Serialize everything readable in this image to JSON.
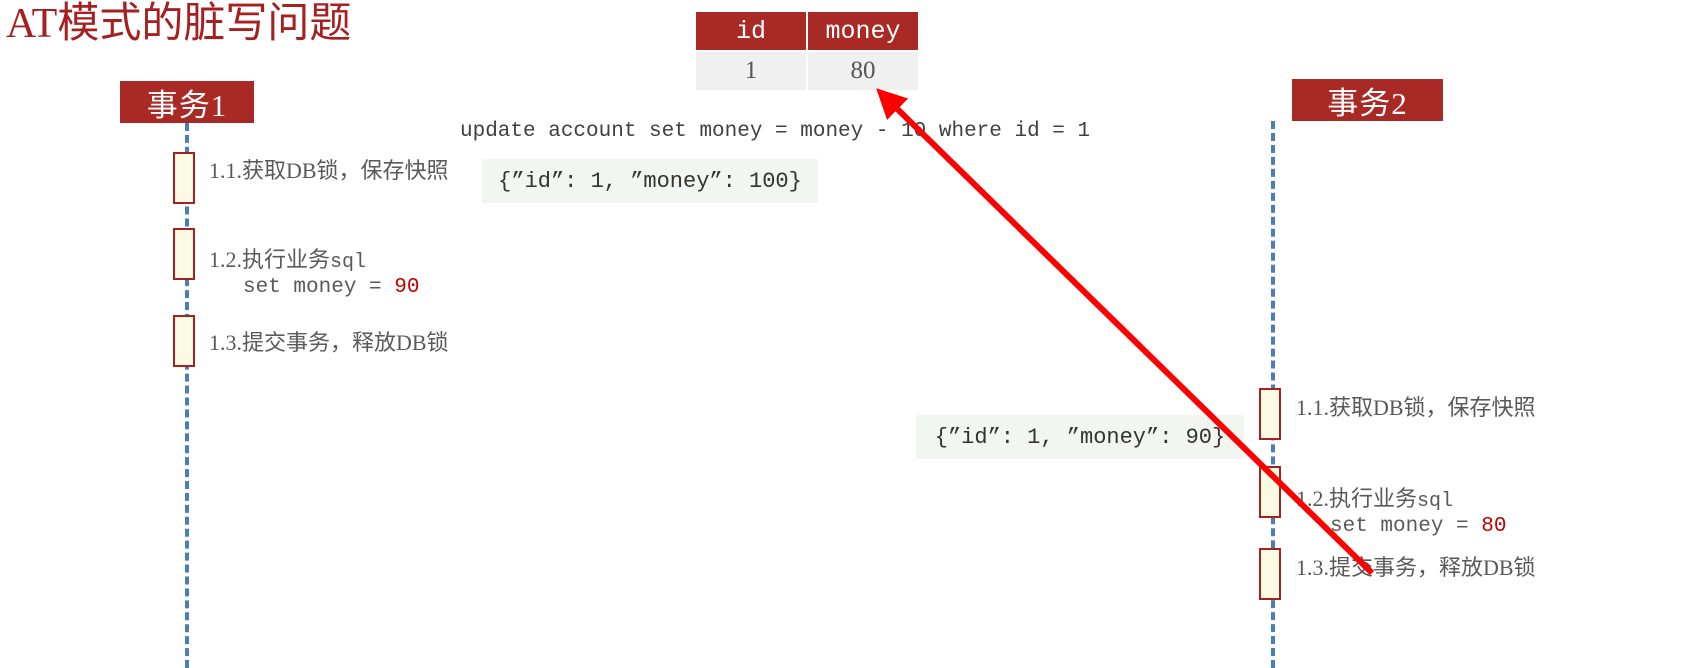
{
  "title": "AT模式的脏写问题",
  "colors": {
    "brand_red": "#a92a25",
    "title_red": "#a52121",
    "activation_fill": "#fbfbe3",
    "lifeline_blue": "#4a7ebb",
    "note_bg": "#f2f6f0",
    "value_red": "#c00000",
    "arrow_red": "#ff0000"
  },
  "db_table": {
    "headers": [
      "id",
      "money"
    ],
    "rows": [
      [
        "1",
        "80"
      ]
    ]
  },
  "sql_statement": "update account set money = money - 10 where id = 1",
  "notes": [
    {
      "text": "{”id”: 1, ”money”: 100}"
    },
    {
      "text": "{”id”: 1, ”money”: 90}"
    }
  ],
  "transactions": [
    {
      "name": "事务1",
      "steps": [
        {
          "label": "1.1.获取DB锁，保存快照",
          "sub": null,
          "sub_value": null
        },
        {
          "label_prefix": "1.2.执行业务",
          "label_mono": "sql",
          "sub": "set money = ",
          "sub_value": "90"
        },
        {
          "label": "1.3.提交事务，释放DB锁",
          "sub": null,
          "sub_value": null
        }
      ]
    },
    {
      "name": "事务2",
      "steps": [
        {
          "label": "1.1.获取DB锁，保存快照",
          "sub": null,
          "sub_value": null
        },
        {
          "label_prefix": "1.2.执行业务",
          "label_mono": "sql",
          "sub": "set money = ",
          "sub_value": "80"
        },
        {
          "label": "1.3.提交事务，释放DB锁",
          "sub": null,
          "sub_value": null
        }
      ]
    }
  ]
}
